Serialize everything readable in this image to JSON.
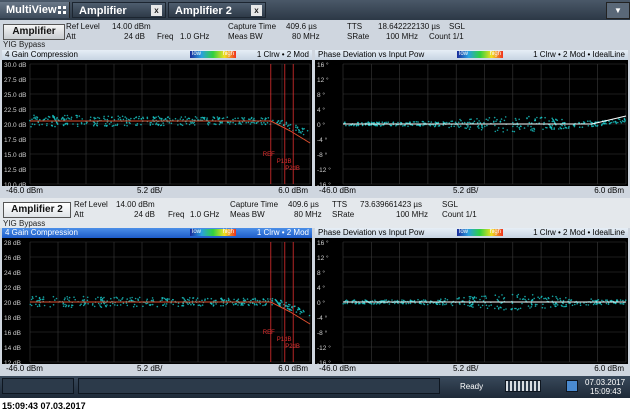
{
  "tabs": [
    {
      "label": "MultiView"
    },
    {
      "label": "Amplifier",
      "close": "x"
    },
    {
      "label": "Amplifier 2",
      "close": "x"
    }
  ],
  "channels": [
    {
      "name": "Amplifier",
      "ref_label": "Ref Level",
      "ref_value": "14.00 dBm",
      "att_label": "Att",
      "att_value": "24 dB",
      "freq_label": "Freq",
      "freq_value": "1.0 GHz",
      "cap_label": "Capture Time",
      "cap_value": "409.6 µs",
      "meas_label": "Meas BW",
      "meas_value": "80 MHz",
      "tts_label": "TTS",
      "tts_value": "18.642222130 µs",
      "srate_label": "SRate",
      "srate_value": "100 MHz",
      "sgl": "SGL",
      "count": "Count 1/1",
      "yig": "YIG Bypass",
      "gain": {
        "title": "4 Gain Compression",
        "low": "low",
        "high": "high",
        "mode": "1 Clrw • 2 Mod",
        "ylabels": [
          "30.0 dB",
          "27.5 dB",
          "25.0 dB",
          "22.5 dB",
          "20.0 dB",
          "17.5 dB",
          "15.0 dB",
          "12.5 dB",
          "10.0 dB"
        ],
        "markers": [
          "REF",
          "P1dB",
          "P2dB"
        ],
        "x_start": "-46.0 dBm",
        "x_div": "5.2 dB/",
        "x_stop": "6.0 dBm"
      },
      "phase": {
        "title": "Phase Deviation vs Input Pow",
        "low": "low",
        "high": "high",
        "mode": "1 Clrw • 2 Mod • IdealLine",
        "ylabels": [
          "16 °",
          "12 °",
          "8 °",
          "4 °",
          "0 °",
          "-4 °",
          "-8 °",
          "-12 °",
          "-16 °"
        ],
        "x_start": "-46.0 dBm",
        "x_div": "5.2 dB/",
        "x_stop": "6.0 dBm"
      }
    },
    {
      "name": "Amplifier 2",
      "ref_label": "Ref Level",
      "ref_value": "14.00 dBm",
      "att_label": "Att",
      "att_value": "24 dB",
      "freq_label": "Freq",
      "freq_value": "1.0 GHz",
      "cap_label": "Capture Time",
      "cap_value": "409.6 µs",
      "meas_label": "Meas BW",
      "meas_value": "80 MHz",
      "tts_label": "TTS",
      "tts_value": "73.639661423 µs",
      "srate_label": "SRate",
      "srate_value": "100 MHz",
      "sgl": "SGL",
      "count": "Count 1/1",
      "yig": "YIG Bypass",
      "gain": {
        "title": "4 Gain Compression",
        "low": "low",
        "high": "high",
        "mode": "1 Clrw • 2 Mod",
        "ylabels": [
          "28 dB",
          "26 dB",
          "24 dB",
          "22 dB",
          "20 dB",
          "18 dB",
          "16 dB",
          "14 dB",
          "12 dB"
        ],
        "markers": [
          "REF",
          "P1dB",
          "P2dB"
        ],
        "x_start": "-46.0 dBm",
        "x_div": "5.2 dB/",
        "x_stop": "6.0 dBm"
      },
      "phase": {
        "title": "Phase Deviation vs Input Pow",
        "low": "low",
        "high": "high",
        "mode": "1 Clrw • 2 Mod • IdealLine",
        "ylabels": [
          "16 °",
          "12 °",
          "8 °",
          "4 °",
          "0 °",
          "-4 °",
          "-8 °",
          "-12 °",
          "-16 °"
        ],
        "x_start": "-46.0 dBm",
        "x_div": "5.2 dB/",
        "x_stop": "6.0 dBm"
      }
    }
  ],
  "status": {
    "ready": "Ready",
    "date": "07.03.2017",
    "time": "15:09:43"
  },
  "footer": {
    "timestamp": "15:09:43  07.03.2017"
  },
  "colors": {
    "trace": "#19c8c8",
    "marker": "#e03030",
    "ideal": "#ffffff",
    "grid": "#3a3a3a",
    "active_header": "#2a6fd8"
  }
}
